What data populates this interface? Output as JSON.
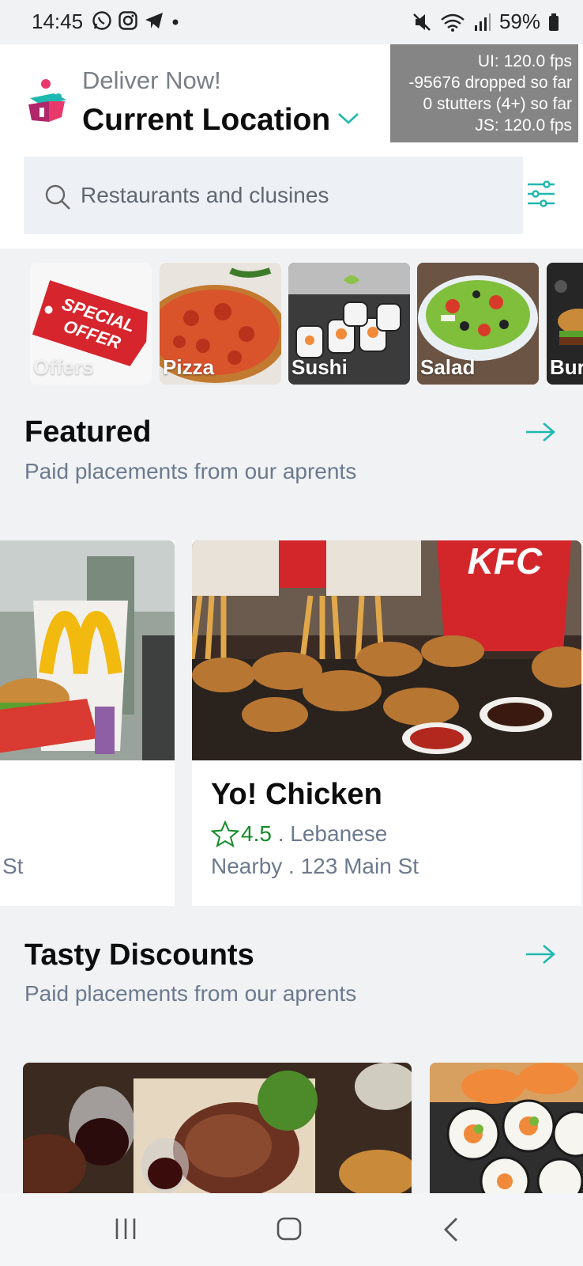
{
  "status_bar": {
    "time": "14:45",
    "left_icons": [
      "whatsapp-icon",
      "instagram-icon",
      "telegram-icon",
      "dot-icon"
    ],
    "right_icons": [
      "mute-icon",
      "wifi-icon",
      "signal-icon",
      "battery-icon"
    ],
    "battery": "59%"
  },
  "header": {
    "deliver_label": "Deliver Now!",
    "location": "Current Location",
    "perf_overlay": [
      "UI: 120.0 fps",
      "-95676 dropped so far",
      "0 stutters (4+) so far",
      "JS: 120.0 fps"
    ]
  },
  "search": {
    "placeholder": "Restaurants and clusines"
  },
  "categories": [
    {
      "label": "Offers",
      "visible": "partly"
    },
    {
      "label": "Pizza"
    },
    {
      "label": "Sushi"
    },
    {
      "label": "Salad"
    },
    {
      "label": "Bur"
    }
  ],
  "featured": {
    "title": "Featured",
    "subtitle": "Paid placements from our aprents",
    "cards": [
      {
        "line2": "St"
      },
      {
        "title": "Yo! Chicken",
        "rating": "4.5",
        "cuisine": " . Lebanese",
        "line2": "Nearby . 123 Main St",
        "brand_text": "KFC"
      }
    ]
  },
  "discounts": {
    "title": "Tasty Discounts",
    "subtitle": "Paid placements from our aprents"
  },
  "colors": {
    "accent": "#1fb8b0",
    "rating_green": "#178a2a",
    "muted_text": "#6c7a8f",
    "background": "#f1f2f4"
  }
}
